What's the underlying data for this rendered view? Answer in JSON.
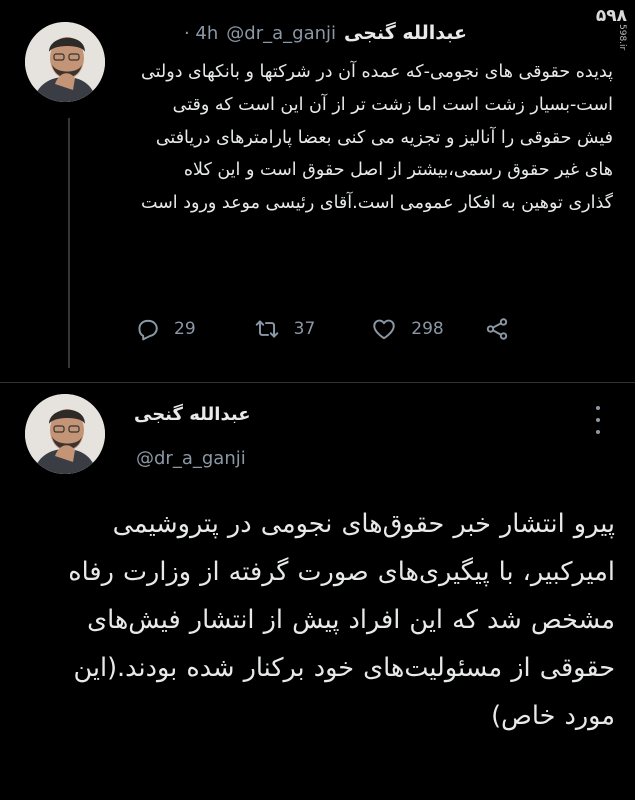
{
  "watermark": {
    "logo": "۵۹۸",
    "site": "598.ir"
  },
  "tweet1": {
    "author_name": "عبدالله گنجی",
    "handle": "@dr_a_ganji",
    "time": "· 4h",
    "text": "پدیده حقوقی های نجومی-که عمده آن در شرکتها و بانکهای دولتی است-بسیار زشت است اما زشت تر از آن این است که وقتی فیش حقوقی را آنالیز و تجزیه می کنی بعضا پارامترهای دریافتی های غیر حقوق رسمی،بیشتر از اصل حقوق است و این کلاه گذاری توهین به افکار عمومی است.آقای رئیسی موعد ورود است",
    "reply_count": "29",
    "retweet_count": "37",
    "like_count": "298"
  },
  "tweet2": {
    "author_name": "عبدالله گنجی",
    "handle": "@dr_a_ganji",
    "text": "پیرو انتشار خبر حقوق‌های نجومی در پتروشیمی امیرکبیر، با پیگیری‌های صورت گرفته از وزارت رفاه مشخص شد که این افراد پیش از انتشار فیش‌های حقوقی از مسئولیت‌های خود برکنار شده بودند.(این مورد خاص)"
  },
  "icons": [
    "reply-icon",
    "retweet-icon",
    "like-icon",
    "share-icon",
    "more-icon"
  ],
  "colors": {
    "background": "#000000",
    "text": "#e7e9ea",
    "muted": "#8b98a5",
    "divider": "#2f3336"
  }
}
